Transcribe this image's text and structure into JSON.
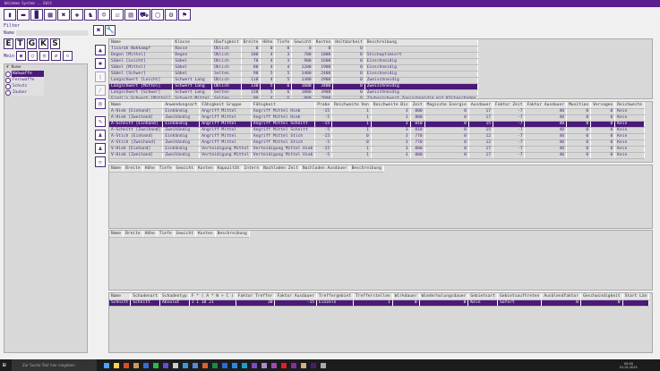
{
  "window": {
    "title": "Waldemo System .. Edit"
  },
  "toolbar": [
    "person-icon",
    "bag-icon",
    "book-icon",
    "calculator-icon",
    "weapons-icon",
    "shield-icon",
    "fighter-icon",
    "group-icon",
    "check-icon",
    "building-icon",
    "truck-icon",
    "document-icon",
    "gear-icon",
    "runner-icon"
  ],
  "filter": {
    "label": "Filter",
    "name_label": "Name",
    "name_value": "",
    "letters": [
      "E",
      "T",
      "G",
      "K",
      "S"
    ],
    "mein_label": "Mein"
  },
  "category_list": {
    "header_hash": "#",
    "header_name": "Name",
    "items": [
      {
        "label": "Nahwaffe",
        "selected": true
      },
      {
        "label": "Fernwaffe",
        "selected": false
      },
      {
        "label": "Schutz",
        "selected": false
      },
      {
        "label": "Zauber",
        "selected": false
      }
    ]
  },
  "weapons": {
    "columns": [
      "Name",
      "Klasse",
      "Häufigkeit",
      "Breite",
      "Höhe",
      "Tiefe",
      "Gewicht",
      "Kosten",
      "Haltbarkeit",
      "Beschreibung"
    ],
    "numeric": [
      3,
      4,
      5,
      6,
      7,
      8
    ],
    "selected": 6,
    "rows": [
      [
        "Tisarah Nahkampf",
        "Rasse",
        "Üblich",
        "0",
        "0",
        "0",
        "0",
        "0",
        "0",
        ""
      ],
      [
        "Degen [Mittel]",
        "Degen",
        "Üblich",
        "100",
        "4",
        "3",
        "700",
        "1000",
        "0",
        "Stichoptimiert"
      ],
      [
        "Säbel [Leicht]",
        "Säbel",
        "Üblich",
        "70",
        "4",
        "3",
        "900",
        "1600",
        "0",
        "Einschneidig"
      ],
      [
        "Säbel [Mittel]",
        "Säbel",
        "Üblich",
        "80",
        "4",
        "4",
        "1200",
        "1900",
        "0",
        "Einschneidig"
      ],
      [
        "Säbel [Schwer]",
        "Säbel",
        "Selten",
        "90",
        "5",
        "5",
        "1400",
        "2400",
        "0",
        "Einschneidig"
      ],
      [
        "Langschwert [Leicht]",
        "Schwert Lang",
        "Üblich",
        "110",
        "4",
        "5",
        "1300",
        "2900",
        "0",
        "Zweischneidig"
      ],
      [
        "Langschwert [Mittel]",
        "Schwert Lang",
        "Üblich",
        "130",
        "5",
        "6",
        "1600",
        "3400",
        "0",
        "Zweischneidig"
      ],
      [
        "Langschwert [Schwer]",
        "Schwert Lang",
        "Selten",
        "150",
        "5",
        "6",
        "1800",
        "3900",
        "0",
        "Zweischneidig"
      ],
      [
        "Findi's Schwert [Mittel]",
        "Schwert Mittel",
        "Selten",
        "90",
        "4",
        "6",
        "900",
        "2000",
        "0",
        "Zauberschwert Zweischneidig mit Kälteschaden"
      ]
    ]
  },
  "attacks": {
    "columns": [
      "Name",
      "Anwendungsart",
      "Fähigkeit Gruppe",
      "Fähigkeit",
      "Probe",
      "Reichweite Von",
      "Reichweite Bis",
      "Zeit",
      "Magische Energie",
      "Ausdauer",
      "Faktor Zeit",
      "Faktor Ausdauer",
      "Munition",
      "Versagen",
      "Reichweite"
    ],
    "numeric": [
      4,
      5,
      6,
      7,
      8,
      9,
      10,
      11,
      12,
      13
    ],
    "selected": 2,
    "rows": [
      [
        "A-Hieb [Einhand]",
        "Einhändig",
        "Angriff Mittel",
        "Angriff Mittel Hieb",
        "-15",
        "1",
        "3",
        "800",
        "0",
        "17",
        "-7",
        "40",
        "0",
        "0",
        "Kein"
      ],
      [
        "A-Hieb [Zweihand]",
        "Zweihändig",
        "Angriff Mittel",
        "Angriff Mittel Hieb",
        "-5",
        "1",
        "3",
        "800",
        "0",
        "17",
        "-7",
        "40",
        "0",
        "0",
        "Kein"
      ],
      [
        "A-Schnitt [Einhand]",
        "Einhändig",
        "Angriff Mittel",
        "Angriff Mittel Schnitt",
        "-15",
        "1",
        "3",
        "810",
        "0",
        "15",
        "-7",
        "40",
        "0",
        "0",
        "Kein"
      ],
      [
        "A-Schnitt [Zweihand]",
        "Zweihändig",
        "Angriff Mittel",
        "Angriff Mittel Schnitt",
        "-5",
        "1",
        "3",
        "810",
        "0",
        "15",
        "-7",
        "40",
        "0",
        "0",
        "Kein"
      ],
      [
        "A-Stich [Einhand]",
        "Einhändig",
        "Angriff Mittel",
        "Angriff Mittel Stich",
        "-15",
        "0",
        "3",
        "770",
        "0",
        "12",
        "-7",
        "40",
        "0",
        "0",
        "Kein"
      ],
      [
        "A-Stich [Zweihand]",
        "Zweihändig",
        "Angriff Mittel",
        "Angriff Mittel Stich",
        "-5",
        "0",
        "3",
        "770",
        "0",
        "12",
        "-7",
        "40",
        "0",
        "0",
        "Kein"
      ],
      [
        "V-Hieb [Einhand]",
        "Einhändig",
        "Verteidigung Mittel",
        "Verteidigung Mittel Hieb",
        "-15",
        "1",
        "3",
        "800",
        "0",
        "17",
        "-7",
        "40",
        "0",
        "0",
        "Kein"
      ],
      [
        "V-Hieb [Zweihand]",
        "Zweihändig",
        "Verteidigung Mittel",
        "Verteidigung Mittel Hieb",
        "-5",
        "1",
        "3",
        "800",
        "0",
        "17",
        "-7",
        "40",
        "0",
        "0",
        "Kein"
      ]
    ]
  },
  "ammo": {
    "columns": [
      "Name",
      "Breite",
      "Höhe",
      "Tiefe",
      "Gewicht",
      "Kosten",
      "Kapazität",
      "Intern",
      "Nachladen Zeit",
      "Nachladen Ausdauer",
      "Beschreibung"
    ],
    "numeric": [],
    "selected": -1,
    "rows": []
  },
  "extras": {
    "columns": [
      "Name",
      "Breite",
      "Höhe",
      "Tiefe",
      "Gewicht",
      "Kosten",
      "Beschreibung"
    ],
    "numeric": [],
    "selected": -1,
    "rows": []
  },
  "damage": {
    "columns": [
      "Name",
      "Schadenart",
      "Schadentyp",
      "F * ( A * W + C )",
      "Faktor Treffer",
      "Faktor Ausdauer",
      "Treffergebiet",
      "Trefferstellen",
      "Wirkdauer",
      "Wiederholungsdauer",
      "Gebietsart",
      "Gebietsauftreten",
      "Ausblendfaktor",
      "Geschwindigkeit",
      "Start Län"
    ],
    "numeric": [
      4,
      5,
      7,
      8,
      9,
      12,
      13
    ],
    "selected": 0,
    "rows": [
      [
        "Schnitt",
        "Schnitt",
        "Absolut",
        "1   1  10  21",
        "30",
        "-15",
        "Einzeln",
        "1",
        "0",
        "0",
        "Kein",
        "Sofort",
        "0",
        "0",
        ""
      ]
    ]
  },
  "taskbar": {
    "search_placeholder": "Zur Suche Text hier eingeben",
    "time": "00:00",
    "date": "01.01.2021"
  },
  "colors": {
    "accent": "#4b1a78",
    "titlebar": "#5b1f8f"
  }
}
